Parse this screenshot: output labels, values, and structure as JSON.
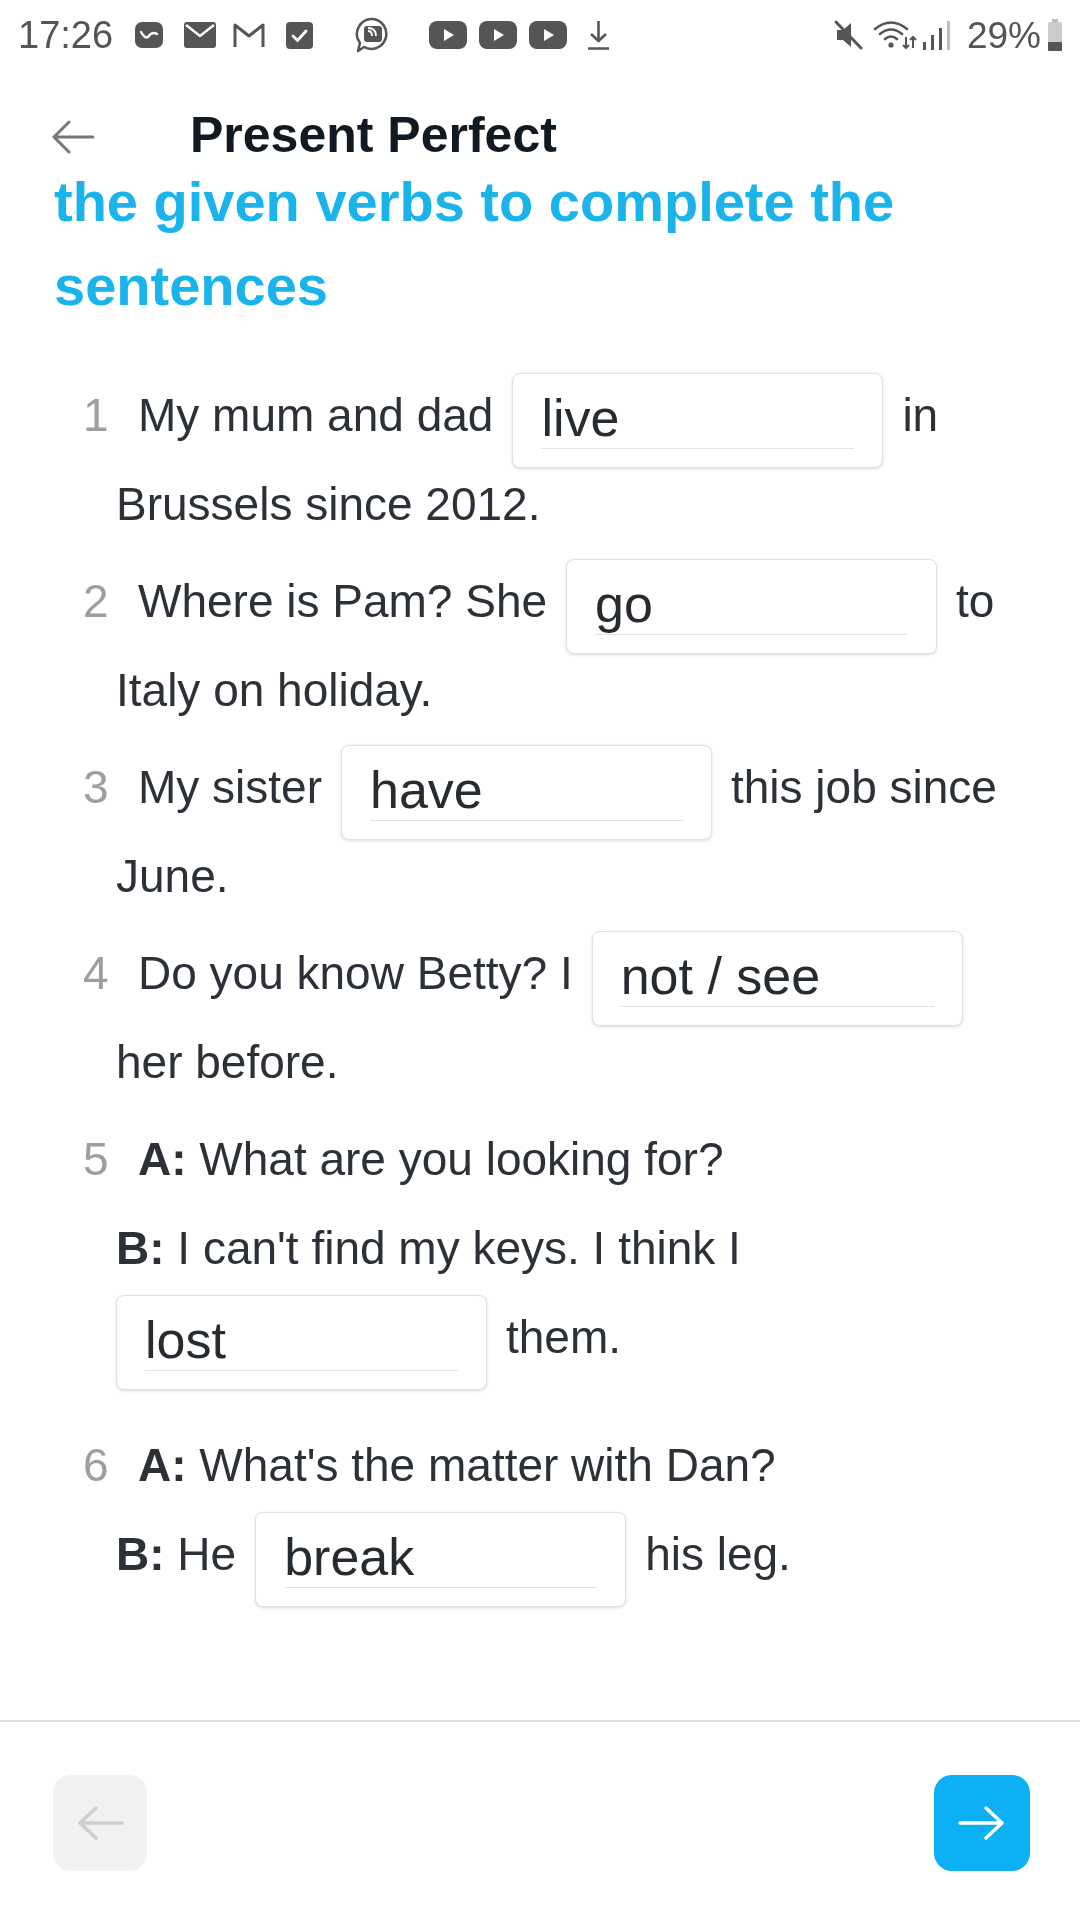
{
  "status_bar": {
    "time": "17:26",
    "battery": "29%"
  },
  "header": {
    "title": "Present Perfect"
  },
  "instruction": "the given verbs to complete the sentences",
  "questions": [
    {
      "number": "1",
      "lines": [
        [
          {
            "kind": "text",
            "text": "My mum and dad"
          },
          {
            "kind": "blank",
            "value": "live"
          },
          {
            "kind": "text",
            "text": "in"
          }
        ],
        [
          {
            "kind": "text",
            "text": "Brussels since 2012."
          }
        ]
      ]
    },
    {
      "number": "2",
      "lines": [
        [
          {
            "kind": "text",
            "text": "Where is Pam? She"
          },
          {
            "kind": "blank",
            "value": "go"
          },
          {
            "kind": "text",
            "text": "to"
          }
        ],
        [
          {
            "kind": "text",
            "text": "Italy on holiday."
          }
        ]
      ]
    },
    {
      "number": "3",
      "lines": [
        [
          {
            "kind": "text",
            "text": "My sister"
          },
          {
            "kind": "blank",
            "value": "have"
          },
          {
            "kind": "text",
            "text": "this job since"
          }
        ],
        [
          {
            "kind": "text",
            "text": "June."
          }
        ]
      ]
    },
    {
      "number": "4",
      "lines": [
        [
          {
            "kind": "text",
            "text": "Do you know Betty? I"
          },
          {
            "kind": "blank",
            "value": "not / see"
          }
        ],
        [
          {
            "kind": "text",
            "text": "her before."
          }
        ]
      ]
    },
    {
      "number": "5",
      "lines": [
        [
          {
            "kind": "text",
            "text": "**A:** What are you looking for?"
          }
        ],
        [
          {
            "kind": "text",
            "text": "**B:** I can't find my keys. I think I"
          }
        ],
        [
          {
            "kind": "blank",
            "value": "lost"
          },
          {
            "kind": "text",
            "text": "them."
          }
        ]
      ]
    },
    {
      "number": "6",
      "lines": [
        [
          {
            "kind": "text",
            "text": "**A:** What's the matter with Dan?"
          }
        ],
        [
          {
            "kind": "text",
            "text": "**B:** He"
          },
          {
            "kind": "blank",
            "value": "break"
          },
          {
            "kind": "text",
            "text": "his leg."
          }
        ]
      ]
    }
  ],
  "footer": {
    "previous": {
      "disabled": true
    },
    "next": {
      "disabled": false
    }
  }
}
